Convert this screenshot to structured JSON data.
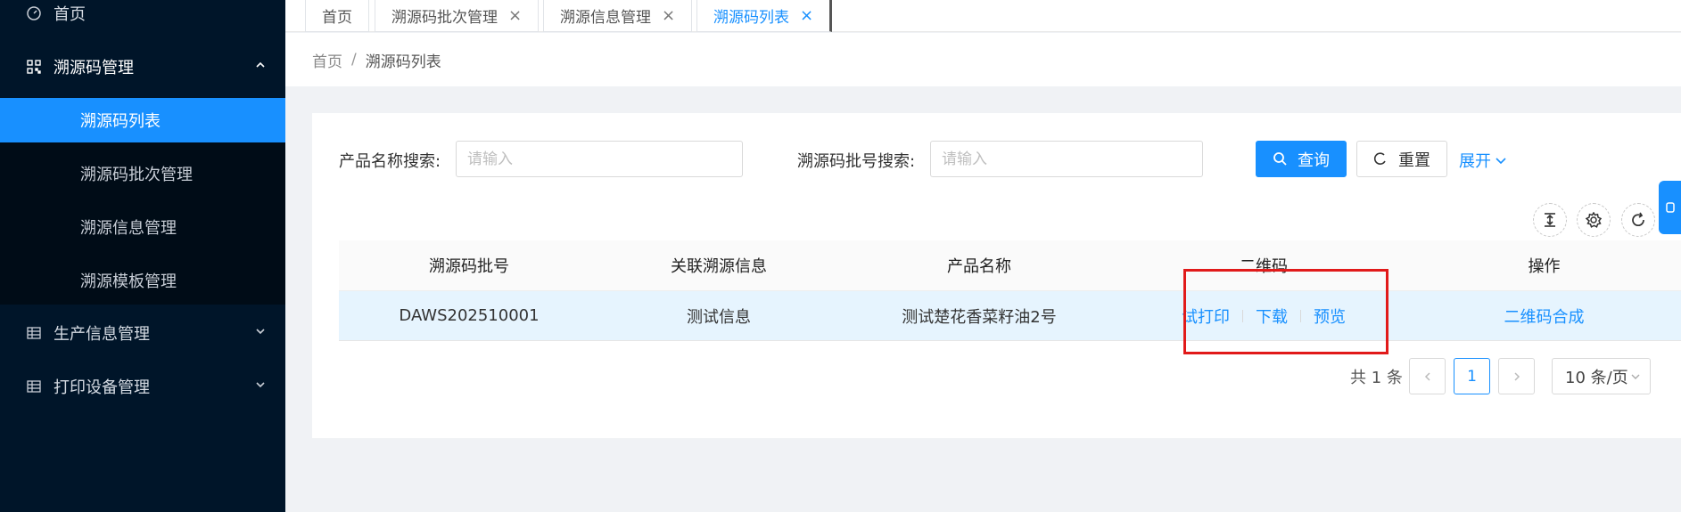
{
  "sidebar": {
    "home": "首页",
    "trace_code_mgmt": "溯源码管理",
    "sub_items": [
      "溯源码列表",
      "溯源码批次管理",
      "溯源信息管理",
      "溯源模板管理"
    ],
    "production_mgmt": "生产信息管理",
    "printer_mgmt": "打印设备管理"
  },
  "tabs": [
    {
      "label": "首页"
    },
    {
      "label": "溯源码批次管理"
    },
    {
      "label": "溯源信息管理"
    },
    {
      "label": "溯源码列表"
    }
  ],
  "breadcrumb": {
    "home": "首页",
    "sep": "/",
    "current": "溯源码列表"
  },
  "search": {
    "product_label": "产品名称搜索:",
    "product_placeholder": "请输入",
    "batch_label": "溯源码批号搜索:",
    "batch_placeholder": "请输入",
    "query_btn": "查询",
    "reset_btn": "重置",
    "expand": "展开"
  },
  "table": {
    "headers": [
      "溯源码批号",
      "关联溯源信息",
      "产品名称",
      "二维码",
      "操作"
    ],
    "rows": [
      {
        "batch": "DAWS202510001",
        "info": "测试信息",
        "product": "测试楚花香菜籽油2号",
        "qr_actions": [
          "试打印",
          "下载",
          "预览"
        ],
        "operation": "二维码合成"
      }
    ]
  },
  "pagination": {
    "total": "共 1 条",
    "current": "1",
    "page_size": "10 条/页"
  },
  "colors": {
    "sidebar": "#001529",
    "primary": "#1890ff",
    "annotation": "#e11a1a"
  }
}
